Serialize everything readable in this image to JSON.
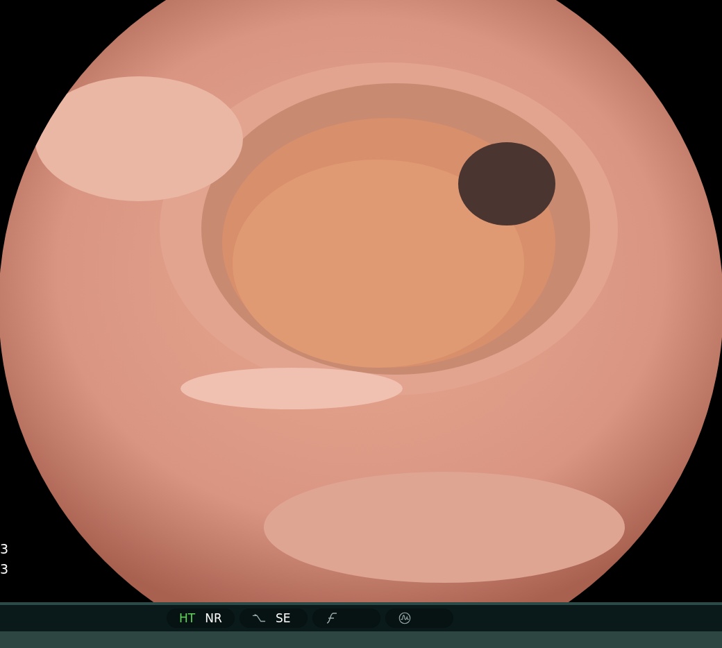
{
  "side_readouts": [
    "3",
    "3"
  ],
  "status_bar": {
    "groups": [
      {
        "kind": "text",
        "labels": [
          {
            "text": "HT",
            "active": true
          },
          {
            "text": "NR",
            "active": false
          }
        ]
      },
      {
        "kind": "curve",
        "labels": [
          {
            "text": "SE",
            "active": false
          }
        ]
      },
      {
        "kind": "f-curve"
      },
      {
        "kind": "wave-circle"
      }
    ]
  }
}
